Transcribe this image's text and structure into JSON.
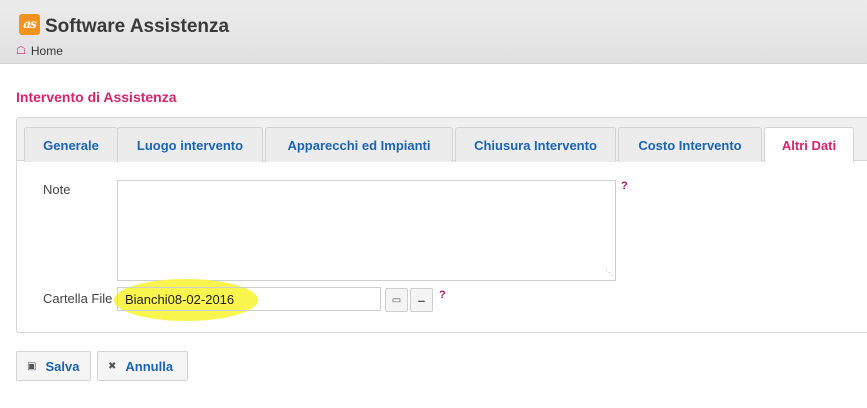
{
  "header": {
    "logo_text": "as",
    "title": "Software Assistenza",
    "breadcrumb": {
      "home_label": "Home"
    }
  },
  "section": {
    "title": "Intervento di Assistenza"
  },
  "tabs": [
    {
      "label": "Generale",
      "active": false
    },
    {
      "label": "Luogo intervento",
      "active": false
    },
    {
      "label": "Apparecchi ed Impianti",
      "active": false
    },
    {
      "label": "Chiusura Intervento",
      "active": false
    },
    {
      "label": "Costo Intervento",
      "active": false
    },
    {
      "label": "Altri Dati",
      "active": true
    }
  ],
  "form": {
    "note": {
      "label": "Note",
      "value": "",
      "help": "?"
    },
    "folder": {
      "label": "Cartella File",
      "value": "Bianchi08-02-2016",
      "help": "?"
    }
  },
  "buttons": {
    "save_label": "Salva",
    "cancel_label": "Annulla"
  },
  "icons": {
    "home": "home-icon",
    "folder": "folder-icon",
    "remove": "minus-icon",
    "save": "floppy-icon",
    "cancel": "close-icon"
  },
  "colors": {
    "accent": "#d4236f",
    "link": "#1a64b4",
    "logo": "#f0941f",
    "highlight": "#f8f545"
  }
}
